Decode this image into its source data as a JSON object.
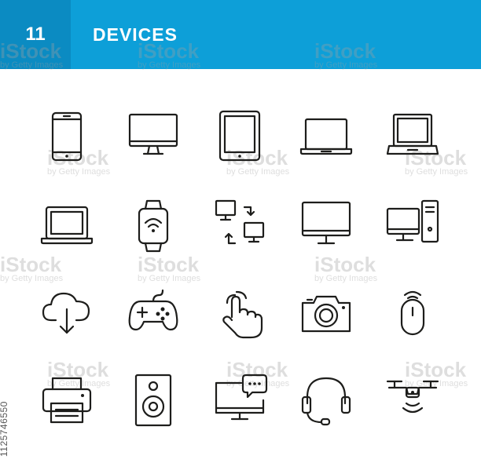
{
  "header": {
    "number": "11",
    "title": "DEVICES",
    "bg_color": "#0d9fd8",
    "num_bg_color": "#0b8bc2"
  },
  "watermark": {
    "brand": "iStock",
    "credit": "by Getty Images"
  },
  "side_id": "1125746550",
  "icons": [
    "smartphone-icon",
    "desktop-monitor-icon",
    "tablet-icon",
    "laptop-icon",
    "laptop-open-icon",
    "laptop-thick-icon",
    "smartwatch-wifi-icon",
    "data-sync-icon",
    "monitor-icon",
    "desktop-tower-icon",
    "cloud-download-icon",
    "gamepad-icon",
    "touch-hand-icon",
    "camera-icon",
    "wireless-mouse-icon",
    "printer-icon",
    "speaker-icon",
    "monitor-chat-icon",
    "headset-icon",
    "drone-icon"
  ]
}
